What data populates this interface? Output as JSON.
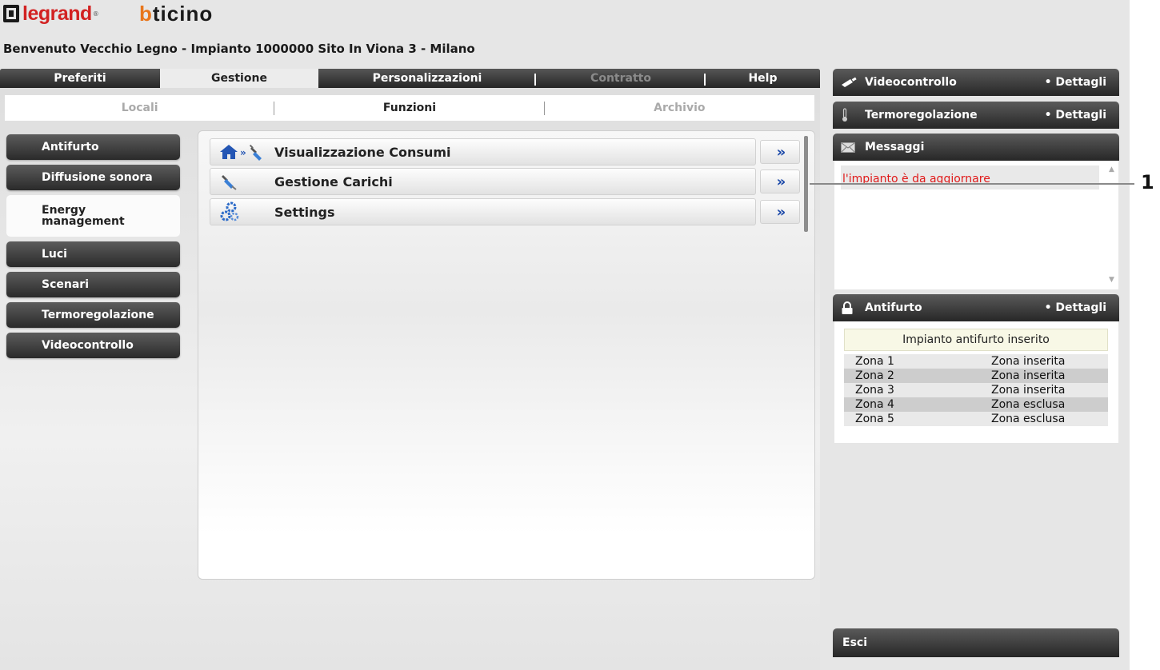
{
  "brand": {
    "legrand": "legrand",
    "bticino_b": "b",
    "bticino_rest": "ticino"
  },
  "welcome": "Benvenuto Vecchio Legno - Impianto 1000000 Sito In Viona 3 - Milano",
  "tabs": [
    {
      "label": "Preferiti"
    },
    {
      "label": "Gestione"
    },
    {
      "label": "Personalizzazioni"
    },
    {
      "label": "Contratto"
    },
    {
      "label": "Help"
    }
  ],
  "subtabs": [
    {
      "label": "Locali"
    },
    {
      "label": "Funzioni"
    },
    {
      "label": "Archivio"
    }
  ],
  "sidebar": {
    "items": [
      {
        "label": "Antifurto"
      },
      {
        "label": "Diffusione sonora"
      },
      {
        "label": "Energy management"
      },
      {
        "label": "Luci"
      },
      {
        "label": "Scenari"
      },
      {
        "label": "Termoregolazione"
      },
      {
        "label": "Videocontrollo"
      }
    ]
  },
  "functions": [
    {
      "label": "Visualizzazione Consumi",
      "icon": "house-plug-icon",
      "go": "»"
    },
    {
      "label": "Gestione Carichi",
      "icon": "plug-icon",
      "go": "»"
    },
    {
      "label": "Settings",
      "icon": "gears-icon",
      "go": "»"
    }
  ],
  "right_panel": {
    "videocontrollo": {
      "title": "Videocontrollo",
      "details": "• Dettagli",
      "icon": "camera-icon"
    },
    "termoregolazione": {
      "title": "Termoregolazione",
      "details": "• Dettagli",
      "icon": "thermometer-icon"
    },
    "messaggi": {
      "title": "Messaggi",
      "icon": "envelope-icon",
      "message": "l'impianto è da aggiornare"
    },
    "antifurto": {
      "title": "Antifurto",
      "details": "• Dettagli",
      "icon": "padlock-icon",
      "status": "Impianto antifurto inserito",
      "zones": [
        {
          "name": "Zona 1",
          "state": "Zona inserita"
        },
        {
          "name": "Zona 2",
          "state": "Zona inserita"
        },
        {
          "name": "Zona 3",
          "state": "Zona inserita"
        },
        {
          "name": "Zona 4",
          "state": "Zona esclusa"
        },
        {
          "name": "Zona 5",
          "state": "Zona esclusa"
        }
      ]
    },
    "esci": "Esci"
  },
  "callout": "1",
  "colors": {
    "accent_red": "#d22222",
    "bticino_orange": "#e8761c",
    "link_blue": "#1846a8",
    "message_red": "#e01a1a"
  }
}
